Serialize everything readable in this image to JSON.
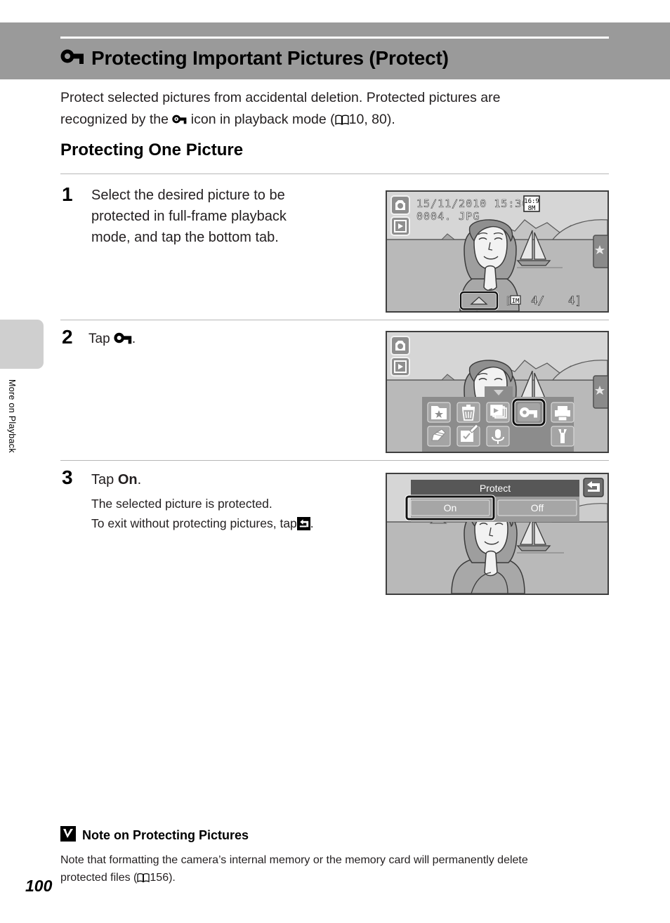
{
  "header": {
    "icon": "key-protect-icon",
    "title": "Protecting Important Pictures (Protect)"
  },
  "intro": {
    "line1": "Protect selected pictures from accidental deletion. Protected pictures are",
    "line2_a": "recognized by the",
    "line2_icon": "key-protect-small-icon",
    "line2_b": "icon in playback mode (",
    "line2_book_icon": "book-reference-icon",
    "line2_c": "10, 80)."
  },
  "section": {
    "heading": "Protecting One Picture"
  },
  "steps": [
    {
      "number": "1",
      "line1": "Select the desired picture to be",
      "line2": "protected in full-frame playback",
      "line3": "mode, and tap the bottom tab."
    },
    {
      "number": "2",
      "text_before": "Tap",
      "icon": "key-protect-icon",
      "text_after": "."
    },
    {
      "number": "3",
      "text_before": "Tap",
      "bold": "On",
      "text_after": ".",
      "sub1": "The selected picture is protected.",
      "sub2_a": "To exit without protecting pictures, tap",
      "sub2_icon": "back-arrow-icon",
      "sub2_b": "."
    }
  ],
  "screenshot1": {
    "name": "full-frame-playback-screen",
    "date": "15/11/2010",
    "time": "15:30",
    "filename": "0004. JPG",
    "quality_badge_top": "16:9",
    "quality_badge_bottom": "8M",
    "frame_counter": "4/   4",
    "memory_icon": "internal-memory-icon",
    "camera_icon": "camera-mode-icon",
    "playback_icon": "playback-mode-icon",
    "favorites_tab_icon": "star-icon",
    "bottom_tab_icon": "up-chevron-icon"
  },
  "screenshot2": {
    "name": "playback-option-menu-screen",
    "camera_icon": "camera-mode-icon",
    "playback_icon": "playback-mode-icon",
    "favorites_tab_icon": "star-icon",
    "menu_icons_row1": [
      "favorites-folder-icon",
      "delete-trash-icon",
      "slideshow-icon",
      "protect-key-icon",
      "print-order-icon"
    ],
    "menu_icons_row2": [
      "paint-retouch-icon",
      "edit-image-icon",
      "voice-memo-icon",
      "setup-wrench-icon"
    ],
    "selected_icon": "protect-key-icon"
  },
  "screenshot3": {
    "name": "protect-dialog-screen",
    "title": "Protect",
    "option_on": "On",
    "option_off": "Off",
    "selected_option": "On",
    "back_icon": "back-arrow-icon"
  },
  "sidebar": {
    "chapter_label": "More on Playback",
    "tab_color": "#cfcfcf"
  },
  "note": {
    "icon": "warning-checkmark-icon",
    "heading": "Note on Protecting Pictures",
    "line1": "Note that formatting the camera’s internal memory or the memory card will permanently delete",
    "line2_a": "protected files (",
    "line2_icon": "book-reference-icon",
    "line2_b": "156)."
  },
  "page": {
    "number": "100"
  },
  "colors": {
    "header_band": "#9a9a9a",
    "rule": "#b7b7b7",
    "lcd_bg": "#c9c9c9",
    "lcd_dark": "#6e6e6e",
    "text": "#231f20"
  }
}
